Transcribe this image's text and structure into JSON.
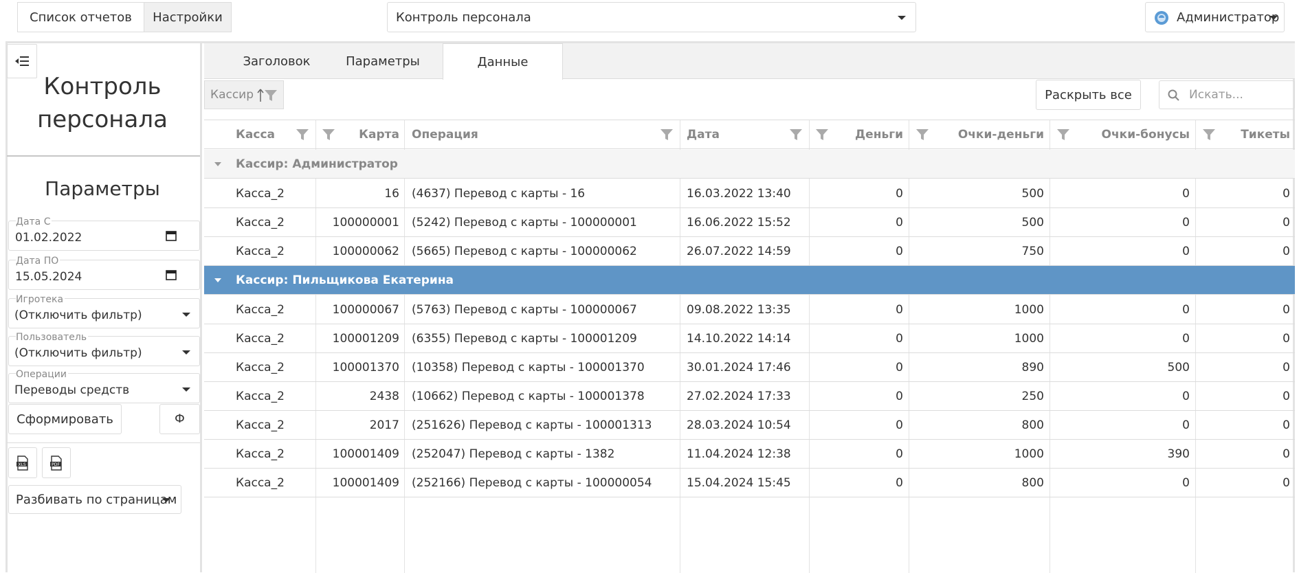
{
  "topbar": {
    "reports_list": "Список отчетов",
    "settings": "Настройки",
    "report_select": "Контроль персонала",
    "user": "Администратор"
  },
  "left": {
    "report_title": "Контроль персонала",
    "params_title": "Параметры",
    "fields": [
      {
        "label": "Дата С",
        "value": "01.02.2022"
      },
      {
        "label": "Дата ПО",
        "value": "15.05.2024"
      },
      {
        "label": "Игротека",
        "value": "(Отключить фильтр)"
      },
      {
        "label": "Пользователь",
        "value": "(Отключить фильтр)"
      },
      {
        "label": "Операции",
        "value": "Переводы средств"
      }
    ],
    "generate_button": "Сформировать",
    "f_button": "Ф",
    "pagination_select": "Разбивать по страницам"
  },
  "tabs": [
    "Заголовок",
    "Параметры",
    "Данные"
  ],
  "toolbar": {
    "group_chip": "Кассир",
    "expand_all": "Раскрыть все",
    "search_placeholder": "Искать..."
  },
  "grid": {
    "columns": [
      "Касса",
      "Карта",
      "Операция",
      "Дата",
      "Деньги",
      "Очки-деньги",
      "Очки-бонусы",
      "Тикеты"
    ],
    "groups": [
      {
        "label": "Кассир: Администратор",
        "rows": [
          [
            "Касса_2",
            "16",
            "(4637) Перевод с карты - 16",
            "16.03.2022 13:40",
            "0",
            "500",
            "0",
            "0"
          ],
          [
            "Касса_2",
            "100000001",
            "(5242) Перевод с карты - 100000001",
            "16.06.2022 15:52",
            "0",
            "500",
            "0",
            "0"
          ],
          [
            "Касса_2",
            "100000062",
            "(5665) Перевод с карты - 100000062",
            "26.07.2022 14:59",
            "0",
            "750",
            "0",
            "0"
          ]
        ]
      },
      {
        "label": "Кассир: Пильщикова Екатерина",
        "rows": [
          [
            "Касса_2",
            "100000067",
            "(5763) Перевод с карты - 100000067",
            "09.08.2022 13:35",
            "0",
            "1000",
            "0",
            "0"
          ],
          [
            "Касса_2",
            "100001209",
            "(6355) Перевод с карты - 100001209",
            "14.10.2022 14:14",
            "0",
            "1000",
            "0",
            "0"
          ],
          [
            "Касса_2",
            "100001370",
            "(10358) Перевод с карты - 100001370",
            "30.01.2024 17:46",
            "0",
            "890",
            "500",
            "0"
          ],
          [
            "Касса_2",
            "2438",
            "(10662) Перевод с карты - 100001378",
            "27.02.2024 17:33",
            "0",
            "250",
            "0",
            "0"
          ],
          [
            "Касса_2",
            "2017",
            "(251626) Перевод с карты - 100001313",
            "28.03.2024 10:54",
            "0",
            "800",
            "0",
            "0"
          ],
          [
            "Касса_2",
            "100001409",
            "(252047) Перевод с карты - 1382",
            "11.04.2024 12:38",
            "0",
            "1000",
            "390",
            "0"
          ],
          [
            "Касса_2",
            "100001409",
            "(252166) Перевод с карты - 100000054",
            "15.04.2024 15:45",
            "0",
            "800",
            "0",
            "0"
          ]
        ]
      }
    ],
    "selected_group": 1
  },
  "colors": {
    "selected_group_bg": "#5f95c6",
    "border": "#dcdcdc"
  }
}
